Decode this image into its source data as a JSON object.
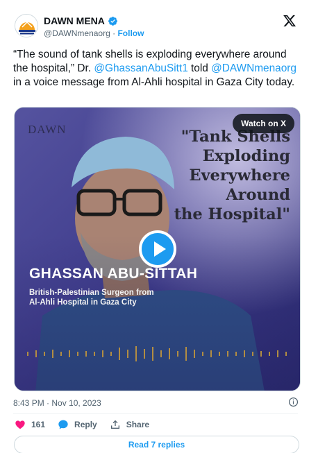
{
  "account": {
    "name": "DAWN MENA",
    "handle": "@DAWNmenaorg",
    "separator": "·",
    "follow_label": "Follow"
  },
  "tweet": {
    "text_1": "“The sound of tank shells is exploding everywhere around the hospital,” Dr. ",
    "mention_1": "@GhassanAbuSitt1",
    "text_2": " told ",
    "mention_2": "@DAWNmenaorg",
    "text_3": " in a voice message from Al-Ahli hospital in Gaza City today."
  },
  "media": {
    "watermark": "DAWN",
    "quote": "\"Tank Shells\nExploding\nEverywhere\nAround\nthe Hospital\"",
    "watch_label": "Watch on X",
    "person_name": "GHASSAN ABU-SITTAH",
    "person_desc": "British-Palestinian Surgeon from\nAl-Ahli Hospital in Gaza City"
  },
  "meta": {
    "timestamp": "8:43 PM · Nov 10, 2023"
  },
  "actions": {
    "like_count": "161",
    "reply_label": "Reply",
    "share_label": "Share",
    "read_replies_label": "Read 7 replies"
  },
  "colors": {
    "accent": "#1d9bf0",
    "like": "#f91880",
    "media_tint": "#3b3a8a"
  },
  "icons": {
    "verified": "verified-badge-icon",
    "x_logo": "x-logo-icon",
    "info": "info-icon",
    "heart": "heart-icon",
    "reply": "reply-bubble-icon",
    "share": "share-icon",
    "play": "play-icon"
  }
}
